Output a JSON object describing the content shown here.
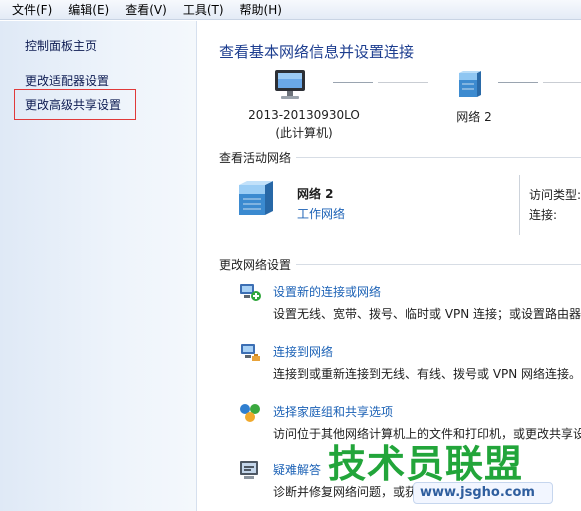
{
  "menu": {
    "file": "文件(F)",
    "edit": "编辑(E)",
    "view": "查看(V)",
    "tools": "工具(T)",
    "help": "帮助(H)"
  },
  "sidebar": {
    "home": "控制面板主页",
    "adapter": "更改适配器设置",
    "sharing": "更改高级共享设置"
  },
  "main": {
    "title": "查看基本网络信息并设置连接",
    "computer_name": "2013-20130930LO",
    "computer_caption": "(此计算机)",
    "network_name": "网络  2"
  },
  "active": {
    "title": "查看活动网络",
    "network_name": "网络  2",
    "network_type": "工作网络",
    "access_type_label": "访问类型:",
    "connection_label": "连接:"
  },
  "settings": {
    "title": "更改网络设置",
    "tasks": [
      {
        "link": "设置新的连接或网络",
        "desc": "设置无线、宽带、拨号、临时或 VPN 连接；或设置路由器"
      },
      {
        "link": "连接到网络",
        "desc": "连接到或重新连接到无线、有线、拨号或 VPN 网络连接。"
      },
      {
        "link": "选择家庭组和共享选项",
        "desc": "访问位于其他网络计算机上的文件和打印机，或更改共享设"
      },
      {
        "link": "疑难解答",
        "desc": "诊断并修复网络问题，或获得故障排除信息"
      }
    ]
  },
  "watermark": {
    "brand": "技术员联盟",
    "url": "www.jsgho.com"
  }
}
